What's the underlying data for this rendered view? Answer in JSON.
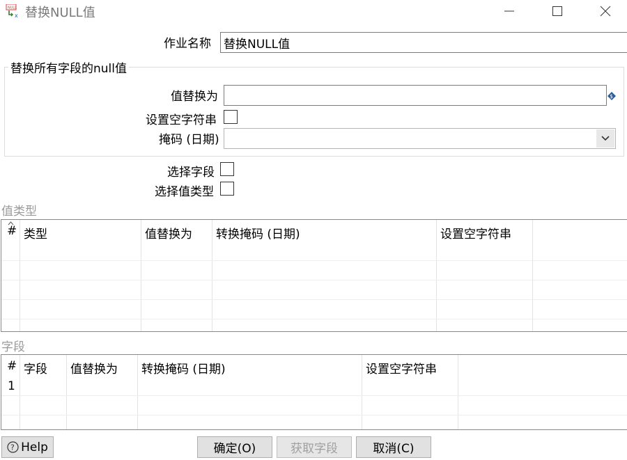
{
  "window": {
    "title": "替换NULL值",
    "minimize_icon": "minimize-icon",
    "maximize_icon": "maximize-icon",
    "close_icon": "close-icon"
  },
  "job_name": {
    "label": "作业名称",
    "value": "替换NULL值"
  },
  "replace_all_group": {
    "title": "替换所有字段的null值",
    "replace_value_label": "值替换为",
    "replace_value": "",
    "set_empty_label": "设置空字符串",
    "set_empty_checked": false,
    "mask_label": "掩码 (日期)",
    "mask_value": ""
  },
  "select_fields": {
    "label": "选择字段",
    "checked": false
  },
  "select_value_types": {
    "label": "选择值类型",
    "checked": false
  },
  "value_types_table": {
    "title": "值类型",
    "columns": [
      "#",
      "类型",
      "值替换为",
      "转换掩码 (日期)",
      "设置空字符串"
    ],
    "rows": []
  },
  "fields_table": {
    "title": "字段",
    "columns": [
      "#",
      "字段",
      "值替换为",
      "转换掩码 (日期)",
      "设置空字符串"
    ],
    "rows": [
      {
        "index": "1",
        "field": "",
        "replace": "",
        "mask": "",
        "set_empty": ""
      }
    ]
  },
  "buttons": {
    "help": "Help",
    "ok": "确定(O)",
    "get_fields": "获取字段",
    "cancel": "取消(C)"
  },
  "colors": {
    "section_title": "#9a9a9a",
    "title_text": "#7a7a7a",
    "button_bg": "#e1e1e1"
  }
}
